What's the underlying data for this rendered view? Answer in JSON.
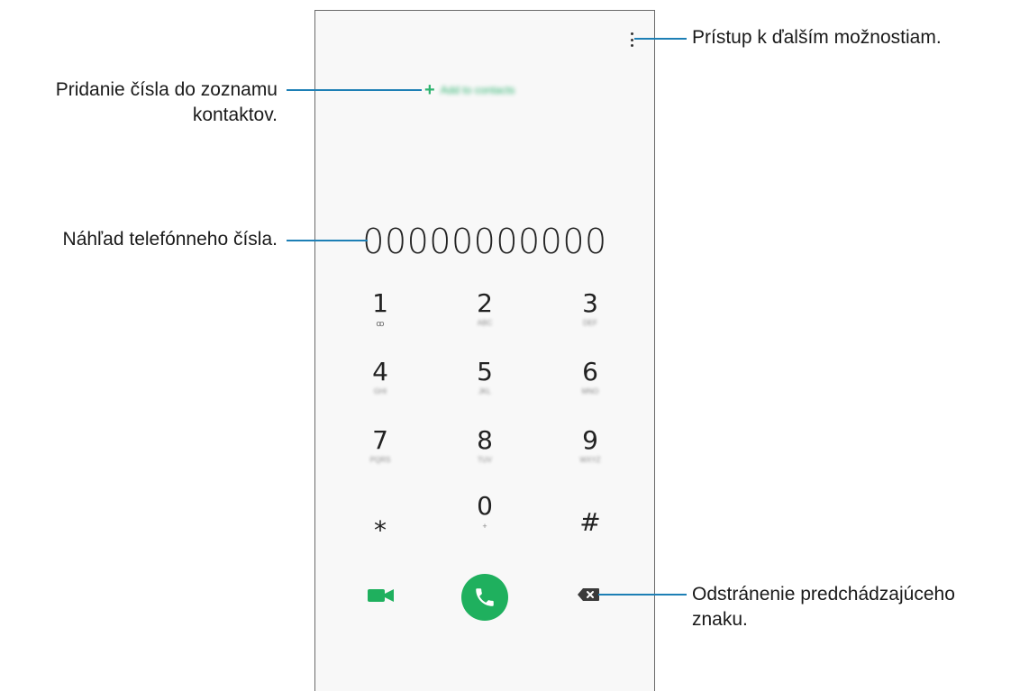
{
  "dialer": {
    "add_to_contacts": "Add to contacts",
    "number": "00000000000",
    "keys": [
      {
        "digit": "1",
        "letters": "ꝏ"
      },
      {
        "digit": "2",
        "letters": "ABC"
      },
      {
        "digit": "3",
        "letters": "DEF"
      },
      {
        "digit": "4",
        "letters": "GHI"
      },
      {
        "digit": "5",
        "letters": "JKL"
      },
      {
        "digit": "6",
        "letters": "MNO"
      },
      {
        "digit": "7",
        "letters": "PQRS"
      },
      {
        "digit": "8",
        "letters": "TUV"
      },
      {
        "digit": "9",
        "letters": "WXYZ"
      },
      {
        "digit": "⁎",
        "letters": ""
      },
      {
        "digit": "0",
        "letters": "+"
      },
      {
        "digit": "#",
        "letters": ""
      }
    ],
    "accent_color": "#1fb05e"
  },
  "annotations": {
    "more_options": "Prístup k ďalším možnostiam.",
    "add_number_line1": "Pridanie čísla do zoznamu",
    "add_number_line2": "kontaktov.",
    "preview": "Náhľad telefónneho čísla.",
    "delete_line1": "Odstránenie predchádzajúceho",
    "delete_line2": "znaku."
  },
  "colors": {
    "leader_line": "#1d7fb5"
  }
}
